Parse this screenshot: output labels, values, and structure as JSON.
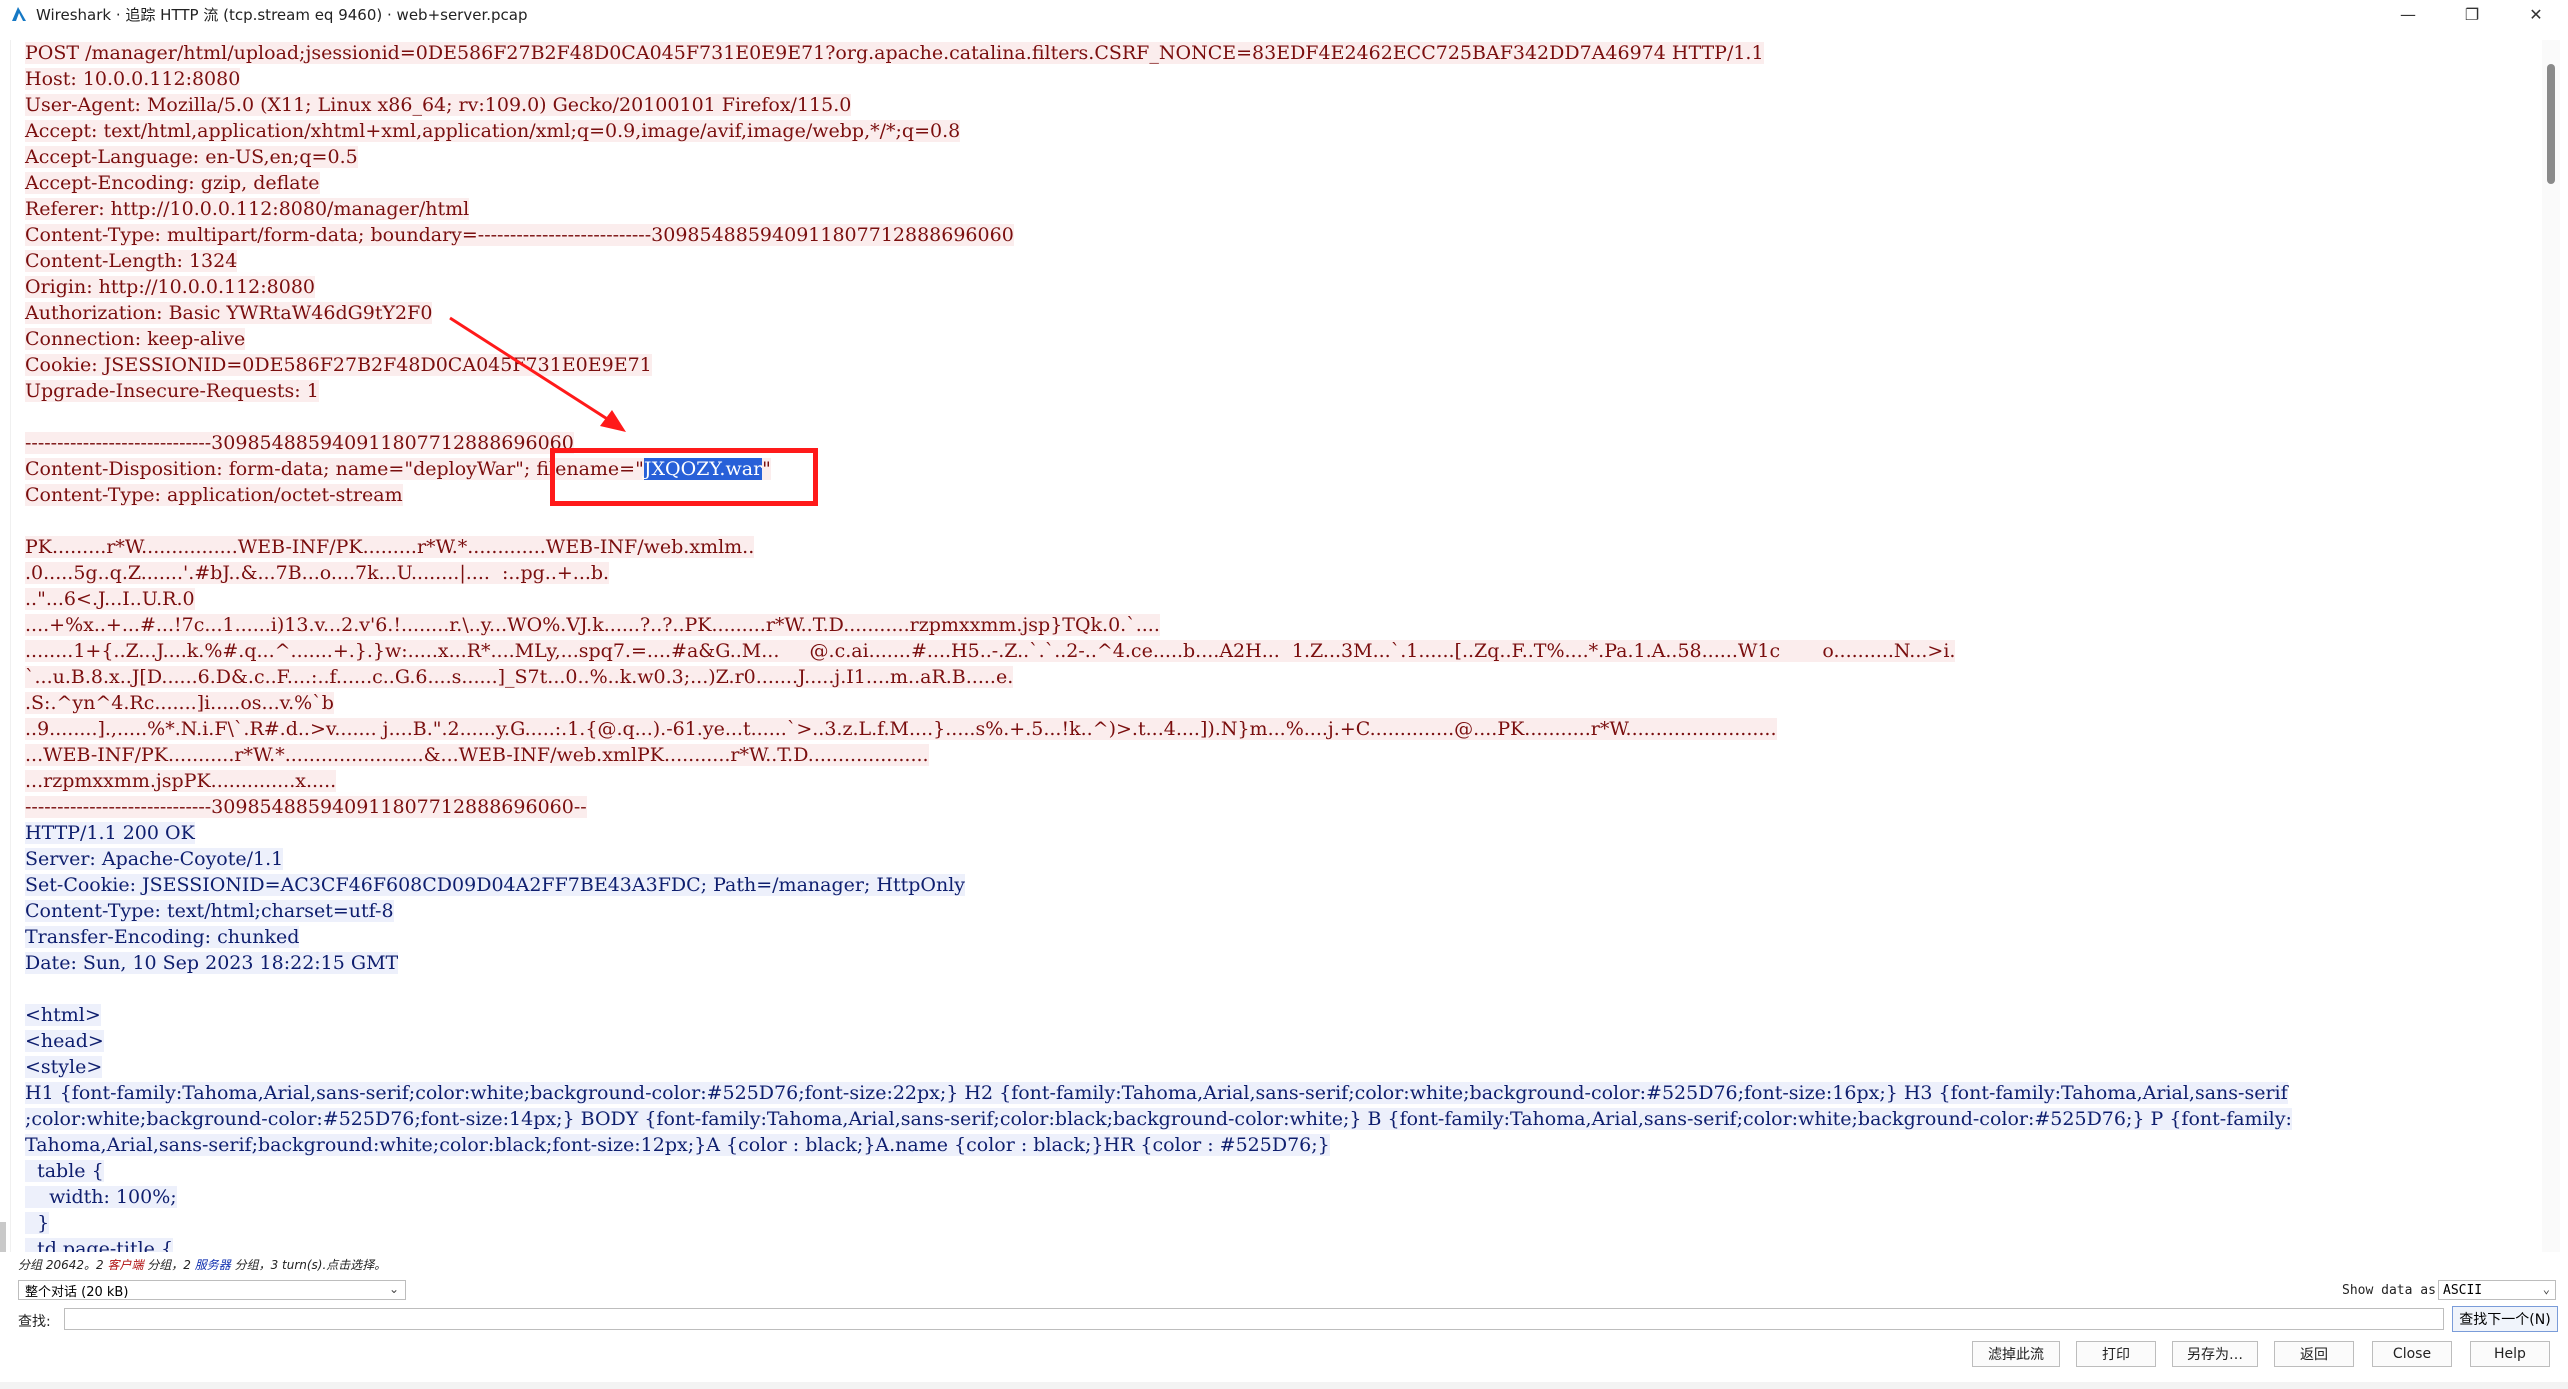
{
  "window": {
    "title": "Wireshark · 追踪 HTTP 流 (tcp.stream eq 9460) · web+server.pcap",
    "minimize": "—",
    "maximize": "❐",
    "close": "✕"
  },
  "stream": {
    "lines": [
      {
        "dir": "client",
        "text": "POST /manager/html/upload;jsessionid=0DE586F27B2F48D0CA045F731E0E9E71?org.apache.catalina.filters.CSRF_NONCE=83EDF4E2462ECC725BAF342DD7A46974 HTTP/1.1"
      },
      {
        "dir": "client",
        "text": "Host: 10.0.0.112:8080"
      },
      {
        "dir": "client",
        "text": "User-Agent: Mozilla/5.0 (X11; Linux x86_64; rv:109.0) Gecko/20100101 Firefox/115.0"
      },
      {
        "dir": "client",
        "text": "Accept: text/html,application/xhtml+xml,application/xml;q=0.9,image/avif,image/webp,*/*;q=0.8"
      },
      {
        "dir": "client",
        "text": "Accept-Language: en-US,en;q=0.5"
      },
      {
        "dir": "client",
        "text": "Accept-Encoding: gzip, deflate"
      },
      {
        "dir": "client",
        "text": "Referer: http://10.0.0.112:8080/manager/html"
      },
      {
        "dir": "client",
        "text": "Content-Type: multipart/form-data; boundary=---------------------------309854885940911807712888696060"
      },
      {
        "dir": "client",
        "text": "Content-Length: 1324"
      },
      {
        "dir": "client",
        "text": "Origin: http://10.0.0.112:8080"
      },
      {
        "dir": "client",
        "text": "Authorization: Basic YWRtaW46dG9tY2F0"
      },
      {
        "dir": "client",
        "text": "Connection: keep-alive"
      },
      {
        "dir": "client",
        "text": "Cookie: JSESSIONID=0DE586F27B2F48D0CA045F731E0E9E71"
      },
      {
        "dir": "client",
        "text": "Upgrade-Insecure-Requests: 1"
      },
      {
        "dir": "blank",
        "text": ""
      },
      {
        "dir": "client",
        "text": "-----------------------------309854885940911807712888696060"
      },
      {
        "dir": "client",
        "text": "Content-Disposition: form-data; name=\"deployWar\"; filename=\"",
        "highlight": "JXQOZY.war",
        "after": "\""
      },
      {
        "dir": "client",
        "text": "Content-Type: application/octet-stream"
      },
      {
        "dir": "blank",
        "text": ""
      },
      {
        "dir": "client",
        "text": "PK.........r*W................WEB-INF/PK.........r*W.*.............WEB-INF/web.xmlm.."
      },
      {
        "dir": "client",
        "text": ".0.....5g..q.Z.......'.#bJ..&...7B...o....7k...U........|....  :..pg..+...b."
      },
      {
        "dir": "client",
        "text": "..\"...6<.J...I..U.R.0"
      },
      {
        "dir": "client",
        "text": "....+%x..+...#...!7c...1......i)13.v...2.v'6.!........r.\\..y...WO%.VJ.k......?..?..PK.........r*W..T.D...........rzpmxxmm.jsp}TQk.0.`...."
      },
      {
        "dir": "client",
        "text": "........1+{..Z...J....k.%#.q...^.......+.}.}w:.....x...R*....MLy,...spq7.=....#a&G..M...     @.c.ai.......#....H5..-.Z..`.`..2-..^4.ce.....b....A2H...  1.Z...3M...`.1......[..Zq..F..T%....*.Pa.1.A..58......W1c       o..........N...>i."
      },
      {
        "dir": "client",
        "text": "`...u.B.8.x..J[D......6.D&.c..F....:..f......c..G.6....s......]_S7t...0..%..k.w0.3;...)Z.r0.......J.....j.I1....m..aR.B.....e."
      },
      {
        "dir": "client",
        "text": ".S:.^yn^4.Rc.......]i.....os...v.%`b"
      },
      {
        "dir": "client",
        "text": "..9........].,.....%*.N.i.F\\`.R#.d..>v....... j....B.\".2......y.G.....:.1.{@.q...).-61.ye...t......`>..3.z.L.f.M....}.....s%.+.5...!k..^)>.t...4....]).N}m...%....j.+C..............@....PK...........r*W........................."
      },
      {
        "dir": "client",
        "text": "...WEB-INF/PK...........r*W.*.......................&...WEB-INF/web.xmlPK...........r*W..T.D...................."
      },
      {
        "dir": "client",
        "text": "...rzpmxxmm.jspPK..............x....."
      },
      {
        "dir": "client",
        "text": "-----------------------------309854885940911807712888696060--"
      },
      {
        "dir": "server",
        "text": "HTTP/1.1 200 OK"
      },
      {
        "dir": "server",
        "text": "Server: Apache-Coyote/1.1"
      },
      {
        "dir": "server",
        "text": "Set-Cookie: JSESSIONID=AC3CF46F608CD09D04A2FF7BE43A3FDC; Path=/manager; HttpOnly"
      },
      {
        "dir": "server",
        "text": "Content-Type: text/html;charset=utf-8"
      },
      {
        "dir": "server",
        "text": "Transfer-Encoding: chunked"
      },
      {
        "dir": "server",
        "text": "Date: Sun, 10 Sep 2023 18:22:15 GMT"
      },
      {
        "dir": "blank",
        "text": ""
      },
      {
        "dir": "server",
        "text": "<html>"
      },
      {
        "dir": "server",
        "text": "<head>"
      },
      {
        "dir": "server",
        "text": "<style>"
      },
      {
        "dir": "server",
        "text": "H1 {font-family:Tahoma,Arial,sans-serif;color:white;background-color:#525D76;font-size:22px;} H2 {font-family:Tahoma,Arial,sans-serif;color:white;background-color:#525D76;font-size:16px;} H3 {font-family:Tahoma,Arial,sans-serif"
      },
      {
        "dir": "server",
        "text": ";color:white;background-color:#525D76;font-size:14px;} BODY {font-family:Tahoma,Arial,sans-serif;color:black;background-color:white;} B {font-family:Tahoma,Arial,sans-serif;color:white;background-color:#525D76;} P {font-family:"
      },
      {
        "dir": "server",
        "text": "Tahoma,Arial,sans-serif;background:white;color:black;font-size:12px;}A {color : black;}A.name {color : black;}HR {color : #525D76;}"
      },
      {
        "dir": "server",
        "text": "  table {"
      },
      {
        "dir": "server",
        "text": "    width: 100%;"
      },
      {
        "dir": "server",
        "text": "  }"
      },
      {
        "dir": "server",
        "text": "  td.page-title {"
      }
    ]
  },
  "status": {
    "prefix": "分组 20642。2 ",
    "client_part": "客户端",
    "mid1": " 分组，2 ",
    "server_part": "服务器",
    "suffix": " 分组，3 turn(s).点击选择。"
  },
  "conversation": {
    "selected": "整个对话 (20 kB)"
  },
  "show_data": {
    "label": "Show data as",
    "selected": "ASCII"
  },
  "find": {
    "label": "查找:",
    "value": "",
    "next_button": "查找下一个(N)"
  },
  "buttons": {
    "filter_out": "滤掉此流",
    "print": "打印",
    "save_as": "另存为…",
    "back": "返回",
    "close": "Close",
    "help": "Help"
  },
  "colors": {
    "client_text": "#7a0e0e",
    "client_bg": "#fbeded",
    "server_text": "#0e1e6e",
    "server_bg": "#edf0fb",
    "annotation": "#ff1a1a",
    "selection": "#2860d8"
  }
}
